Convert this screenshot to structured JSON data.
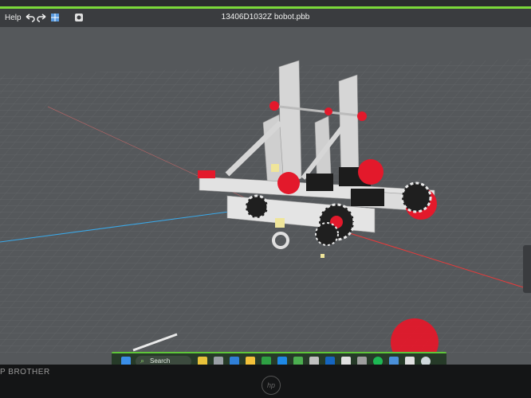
{
  "toolbar": {
    "help_label": "Help",
    "undo_icon": "undo-icon",
    "redo_icon": "redo-icon",
    "grid_icon": "grid-icon",
    "view_icon": "view-icon"
  },
  "window": {
    "title": "13406D1032Z bobot.pbb"
  },
  "taskbar": {
    "search_label": "Search"
  },
  "monitor": {
    "brand_text": "P BROTHER",
    "logo_text": "hp"
  },
  "colors": {
    "accent": "#5fc63a",
    "robot_red": "#e3192b",
    "metal": "#d6d6d6",
    "grid_bg": "#55585b"
  }
}
